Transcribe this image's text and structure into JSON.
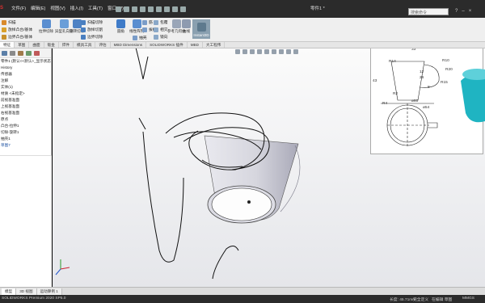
{
  "app": {
    "brand": "S",
    "doc_title": "零件1 *",
    "search_placeholder": "搜索命令"
  },
  "menu": [
    "文件(F)",
    "编辑(E)",
    "视图(V)",
    "插入(I)",
    "工具(T)",
    "窗口(W)"
  ],
  "ribbon": {
    "left_groups": [
      [
        "扫描",
        "放样凸台/基体",
        "边界凸台/基体"
      ],
      [
        "扫描切除",
        "放样切割",
        "边界切除"
      ]
    ],
    "big_buttons": [
      "拉伸切除",
      "异型孔向导",
      "旋转切除"
    ],
    "feature_items": [
      "圆角",
      "线性阵列",
      "筋",
      "拔模",
      "抽壳",
      "包覆",
      "相交",
      "镜向"
    ],
    "ref_label": "参考几何体",
    "curves_label": "曲线",
    "instant3d": "Instant3D"
  },
  "command_tabs": [
    "特征",
    "草图",
    "曲面",
    "钣金",
    "焊件",
    "模具工具",
    "评估",
    "MBD Dimensions",
    "SOLIDWORKS 插件",
    "MBD",
    "大工程伟"
  ],
  "feature_tree": {
    "items": [
      "零件1 (默认<<默认>_显示状态 1>)",
      "History",
      "传感器",
      "注解",
      "实体(1)",
      "材质 <未指定>",
      "前视基准面",
      "上视基准面",
      "右视基准面",
      "原点",
      "凸台-拉伸1",
      "切除-旋转1",
      "抽壳1",
      "草图7"
    ]
  },
  "drawing": {
    "dims": [
      "33",
      "R14",
      "R10",
      "12",
      "26",
      "R4",
      "R15",
      "R20",
      "8",
      "43",
      "R2",
      "ø60",
      "ø54"
    ]
  },
  "bottom_tabs": [
    "模型",
    "3D 视图",
    "运动算例 1"
  ],
  "status": {
    "left": "SOLIDWORKS Premium 2020 SP5.0",
    "length": "长度: 45.71mm",
    "state": "完全定义",
    "mode": "在编辑 草图",
    "units": "MMGS"
  },
  "colors": {
    "titlebar": "#2b2b2b",
    "ribbon": "#efefef",
    "instant3d": "#8aa0b0",
    "cup_shade": "#c8c8d2",
    "teal_preview": "#1fb4c2",
    "ink": "#111111"
  }
}
